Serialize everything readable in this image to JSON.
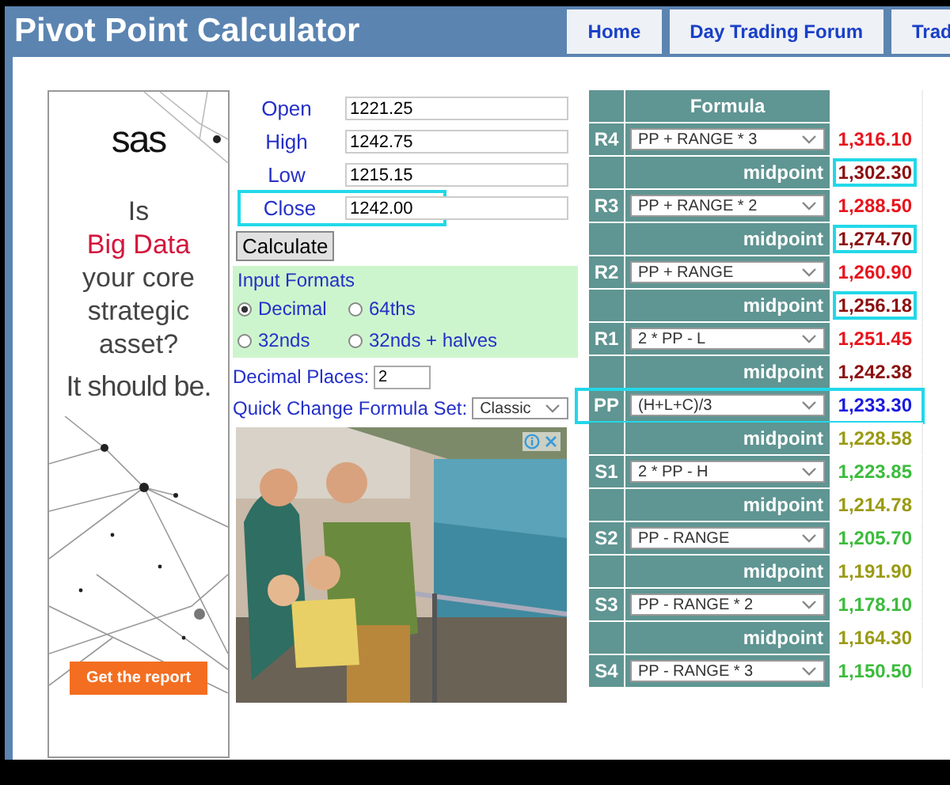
{
  "header": {
    "title": "Pivot Point Calculator",
    "nav": [
      {
        "label": "Home"
      },
      {
        "label": "Day Trading Forum"
      },
      {
        "label": "Trad"
      }
    ]
  },
  "ad": {
    "lines": [
      {
        "text": "Is",
        "kind": "plain"
      },
      {
        "text": "Big Data",
        "kind": "accent"
      },
      {
        "text": "your core",
        "kind": "plain"
      },
      {
        "text": "strategic",
        "kind": "plain"
      },
      {
        "text": "asset?",
        "kind": "plain"
      },
      {
        "text": "It should be.",
        "kind": "large"
      }
    ],
    "logo": "sas",
    "button": "Get the report"
  },
  "inputs": [
    {
      "label": "Open",
      "value": "1221.25",
      "highlighted": false
    },
    {
      "label": "High",
      "value": "1242.75",
      "highlighted": false
    },
    {
      "label": "Low",
      "value": "1215.15",
      "highlighted": false
    },
    {
      "label": "Close",
      "value": "1242.00",
      "highlighted": true
    }
  ],
  "calculate_button": "Calculate",
  "input_formats": {
    "title": "Input Formats",
    "options": [
      {
        "label": "Decimal",
        "selected": true
      },
      {
        "label": "64ths",
        "selected": false
      },
      {
        "label": "32nds",
        "selected": false
      },
      {
        "label": "32nds + halves",
        "selected": false
      }
    ]
  },
  "decimal_places": {
    "label": "Decimal Places:",
    "value": "2"
  },
  "formula_set": {
    "label": "Quick Change Formula Set:",
    "value": "Classic"
  },
  "table": {
    "header": "Formula",
    "rows": [
      {
        "kind": "level",
        "label": "R4",
        "formula": "PP + RANGE * 3",
        "value": "1,316.10",
        "color": "#e8141c",
        "highlighted": false
      },
      {
        "kind": "midpoint",
        "label": "midpoint",
        "value": "1,302.30",
        "color": "#8b1010",
        "highlighted": true
      },
      {
        "kind": "level",
        "label": "R3",
        "formula": "PP + RANGE * 2",
        "value": "1,288.50",
        "color": "#e8141c",
        "highlighted": false
      },
      {
        "kind": "midpoint",
        "label": "midpoint",
        "value": "1,274.70",
        "color": "#8b1010",
        "highlighted": true
      },
      {
        "kind": "level",
        "label": "R2",
        "formula": "PP + RANGE",
        "value": "1,260.90",
        "color": "#e8141c",
        "highlighted": false
      },
      {
        "kind": "midpoint",
        "label": "midpoint",
        "value": "1,256.18",
        "color": "#8b1010",
        "highlighted": true
      },
      {
        "kind": "level",
        "label": "R1",
        "formula": "2 * PP - L",
        "value": "1,251.45",
        "color": "#e8141c",
        "highlighted": false
      },
      {
        "kind": "midpoint",
        "label": "midpoint",
        "value": "1,242.38",
        "color": "#8b1010",
        "highlighted": false
      },
      {
        "kind": "level",
        "label": "PP",
        "formula": "(H+L+C)/3",
        "value": "1,233.30",
        "color": "#1a1ae0",
        "highlighted": true
      },
      {
        "kind": "midpoint",
        "label": "midpoint",
        "value": "1,228.58",
        "color": "#9a9a14",
        "highlighted": false
      },
      {
        "kind": "level",
        "label": "S1",
        "formula": "2 * PP - H",
        "value": "1,223.85",
        "color": "#3cbc3c",
        "highlighted": false
      },
      {
        "kind": "midpoint",
        "label": "midpoint",
        "value": "1,214.78",
        "color": "#9a9a14",
        "highlighted": false
      },
      {
        "kind": "level",
        "label": "S2",
        "formula": "PP - RANGE",
        "value": "1,205.70",
        "color": "#3cbc3c",
        "highlighted": false
      },
      {
        "kind": "midpoint",
        "label": "midpoint",
        "value": "1,191.90",
        "color": "#9a9a14",
        "highlighted": false
      },
      {
        "kind": "level",
        "label": "S3",
        "formula": "PP - RANGE * 2",
        "value": "1,178.10",
        "color": "#3cbc3c",
        "highlighted": false
      },
      {
        "kind": "midpoint",
        "label": "midpoint",
        "value": "1,164.30",
        "color": "#9a9a14",
        "highlighted": false
      },
      {
        "kind": "level",
        "label": "S4",
        "formula": "PP - RANGE * 3",
        "value": "1,150.50",
        "color": "#3cbc3c",
        "highlighted": false
      }
    ]
  }
}
